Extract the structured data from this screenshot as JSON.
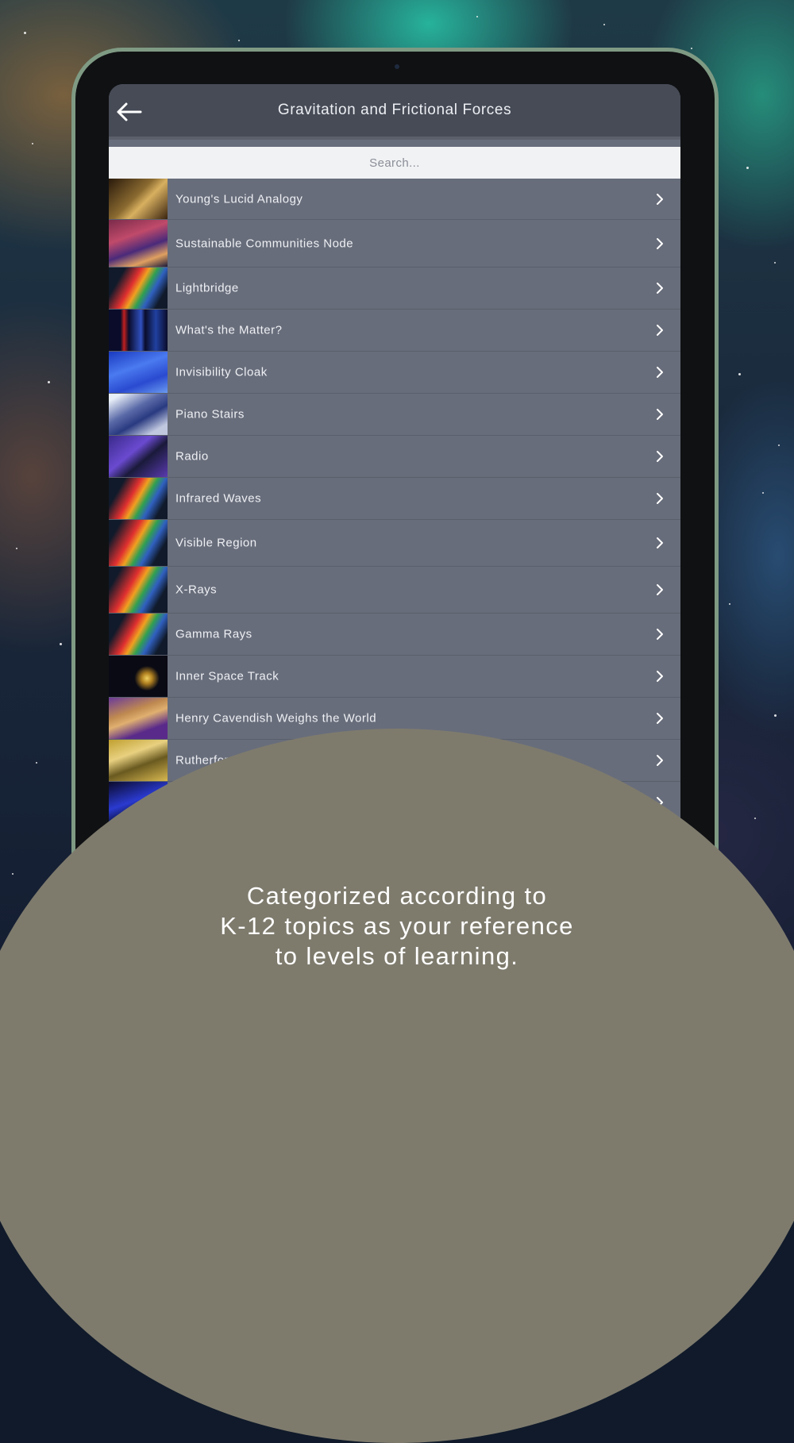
{
  "header": {
    "title": "Gravitation and Frictional Forces",
    "back_icon": "arrow-left-icon"
  },
  "search": {
    "placeholder": "Search..."
  },
  "list": {
    "chevron_icon": "chevron-right-icon",
    "items": [
      {
        "label": "Young's Lucid Analogy"
      },
      {
        "label": "Sustainable Communities Node"
      },
      {
        "label": "Lightbridge"
      },
      {
        "label": "What's the Matter?"
      },
      {
        "label": "Invisibility Cloak"
      },
      {
        "label": "Piano Stairs"
      },
      {
        "label": "Radio"
      },
      {
        "label": "Infrared Waves"
      },
      {
        "label": "Visible Region"
      },
      {
        "label": "X-Rays"
      },
      {
        "label": "Gamma Rays"
      },
      {
        "label": "Inner Space Track"
      },
      {
        "label": "Henry Cavendish Weighs the World"
      },
      {
        "label": "Rutherfor"
      },
      {
        "label": ""
      }
    ]
  },
  "promo": {
    "lines": [
      "Categorized according to",
      "K-12 topics as your reference",
      "to levels of learning."
    ]
  },
  "colors": {
    "navbar": "#464b56",
    "list_row": "#686d7b",
    "promo_bubble": "#7e7b6d"
  }
}
